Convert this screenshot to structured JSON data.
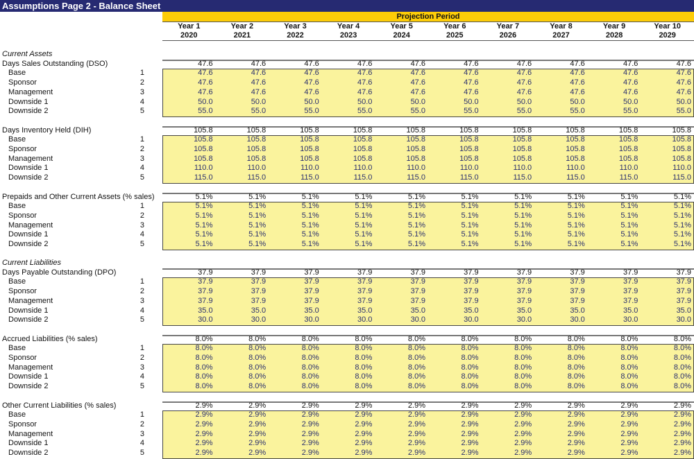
{
  "title": "Assumptions Page 2 - Balance Sheet",
  "projection_label": "Projection Period",
  "columns": [
    {
      "year": "Year 1",
      "date": "2020"
    },
    {
      "year": "Year 2",
      "date": "2021"
    },
    {
      "year": "Year 3",
      "date": "2022"
    },
    {
      "year": "Year 4",
      "date": "2023"
    },
    {
      "year": "Year 5",
      "date": "2024"
    },
    {
      "year": "Year 6",
      "date": "2025"
    },
    {
      "year": "Year 7",
      "date": "2026"
    },
    {
      "year": "Year 8",
      "date": "2027"
    },
    {
      "year": "Year 9",
      "date": "2028"
    },
    {
      "year": "Year 10",
      "date": "2029"
    }
  ],
  "sections": [
    {
      "title": "Current Assets",
      "groups": [
        {
          "label": "Days Sales Outstanding (DSO)",
          "active": "47.6",
          "cases": [
            {
              "name": "Base",
              "num": "1",
              "value": "47.6"
            },
            {
              "name": "Sponsor",
              "num": "2",
              "value": "47.6"
            },
            {
              "name": "Management",
              "num": "3",
              "value": "47.6"
            },
            {
              "name": "Downside 1",
              "num": "4",
              "value": "50.0"
            },
            {
              "name": "Downside 2",
              "num": "5",
              "value": "55.0"
            }
          ]
        },
        {
          "label": "Days Inventory Held (DIH)",
          "active": "105.8",
          "cases": [
            {
              "name": "Base",
              "num": "1",
              "value": "105.8"
            },
            {
              "name": "Sponsor",
              "num": "2",
              "value": "105.8"
            },
            {
              "name": "Management",
              "num": "3",
              "value": "105.8"
            },
            {
              "name": "Downside 1",
              "num": "4",
              "value": "110.0"
            },
            {
              "name": "Downside 2",
              "num": "5",
              "value": "115.0"
            }
          ]
        },
        {
          "label": "Prepaids and Other Current Assets (% sales)",
          "active": "5.1%",
          "cases": [
            {
              "name": "Base",
              "num": "1",
              "value": "5.1%"
            },
            {
              "name": "Sponsor",
              "num": "2",
              "value": "5.1%"
            },
            {
              "name": "Management",
              "num": "3",
              "value": "5.1%"
            },
            {
              "name": "Downside 1",
              "num": "4",
              "value": "5.1%"
            },
            {
              "name": "Downside 2",
              "num": "5",
              "value": "5.1%"
            }
          ]
        }
      ]
    },
    {
      "title": "Current Liabilities",
      "groups": [
        {
          "label": "Days Payable Outstanding (DPO)",
          "active": "37.9",
          "cases": [
            {
              "name": "Base",
              "num": "1",
              "value": "37.9"
            },
            {
              "name": "Sponsor",
              "num": "2",
              "value": "37.9"
            },
            {
              "name": "Management",
              "num": "3",
              "value": "37.9"
            },
            {
              "name": "Downside 1",
              "num": "4",
              "value": "35.0"
            },
            {
              "name": "Downside 2",
              "num": "5",
              "value": "30.0"
            }
          ]
        },
        {
          "label": "Accrued Liabilities (% sales)",
          "active": "8.0%",
          "cases": [
            {
              "name": "Base",
              "num": "1",
              "value": "8.0%"
            },
            {
              "name": "Sponsor",
              "num": "2",
              "value": "8.0%"
            },
            {
              "name": "Management",
              "num": "3",
              "value": "8.0%"
            },
            {
              "name": "Downside 1",
              "num": "4",
              "value": "8.0%"
            },
            {
              "name": "Downside 2",
              "num": "5",
              "value": "8.0%"
            }
          ]
        },
        {
          "label": "Other Current Liabilities (% sales)",
          "active": "2.9%",
          "cases": [
            {
              "name": "Base",
              "num": "1",
              "value": "2.9%"
            },
            {
              "name": "Sponsor",
              "num": "2",
              "value": "2.9%"
            },
            {
              "name": "Management",
              "num": "3",
              "value": "2.9%"
            },
            {
              "name": "Downside 1",
              "num": "4",
              "value": "2.9%"
            },
            {
              "name": "Downside 2",
              "num": "5",
              "value": "2.9%"
            }
          ]
        }
      ]
    }
  ]
}
